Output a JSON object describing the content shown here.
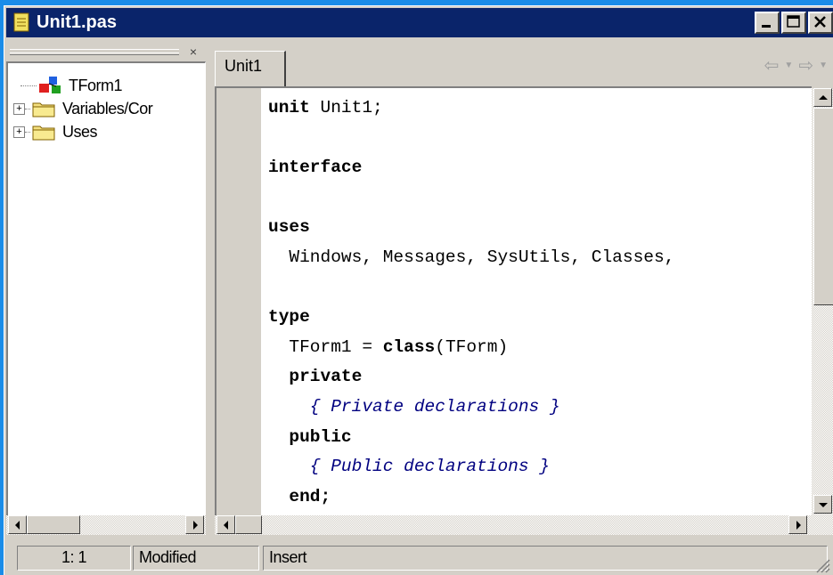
{
  "window": {
    "title": "Unit1.pas",
    "title_bar_color": "#0a246a",
    "background_color": "#1a8ce8"
  },
  "title_buttons": [
    "minimize",
    "maximize",
    "close"
  ],
  "tree": {
    "close_glyph": "×",
    "items": [
      {
        "label": "TForm1",
        "icon": "form-class-icon",
        "expandable": false
      },
      {
        "label": "Variables/Cor",
        "icon": "folder-icon",
        "expandable": true
      },
      {
        "label": "Uses",
        "icon": "folder-icon",
        "expandable": true
      }
    ]
  },
  "tabs": [
    {
      "label": "Unit1",
      "active": true
    }
  ],
  "nav": {
    "back_icon": "back-arrow-icon",
    "forward_icon": "forward-arrow-icon"
  },
  "editor": {
    "lines": [
      [
        {
          "t": "unit",
          "s": "kw"
        },
        {
          "t": " Unit1;",
          "s": ""
        }
      ],
      [],
      [
        {
          "t": "interface",
          "s": "kw"
        }
      ],
      [],
      [
        {
          "t": "uses",
          "s": "kw"
        }
      ],
      [
        {
          "t": "  Windows, Messages, SysUtils, Classes,",
          "s": ""
        }
      ],
      [],
      [
        {
          "t": "type",
          "s": "kw"
        }
      ],
      [
        {
          "t": "  TForm1 = ",
          "s": ""
        },
        {
          "t": "class",
          "s": "kw"
        },
        {
          "t": "(TForm)",
          "s": ""
        }
      ],
      [
        {
          "t": "  ",
          "s": ""
        },
        {
          "t": "private",
          "s": "kw"
        }
      ],
      [
        {
          "t": "    { Private declarations }",
          "s": "cm"
        }
      ],
      [
        {
          "t": "  ",
          "s": ""
        },
        {
          "t": "public",
          "s": "kw"
        }
      ],
      [
        {
          "t": "    { Public declarations }",
          "s": "cm"
        }
      ],
      [
        {
          "t": "  ",
          "s": ""
        },
        {
          "t": "end;",
          "s": "kw"
        }
      ]
    ]
  },
  "status": {
    "position": "1:  1",
    "modified": "Modified",
    "mode": "Insert"
  }
}
